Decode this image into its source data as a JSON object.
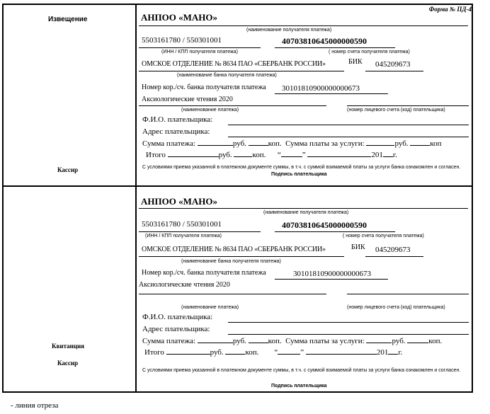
{
  "form_number": "Форма № ПД-4",
  "cut_line_note": "- линия отреза",
  "notice": {
    "title": "Извещение",
    "cashier": "Кассир"
  },
  "receipt_label": {
    "title": "Квитанция",
    "cashier": "Кассир"
  },
  "sections": [
    {
      "payee_name": "АНПОО «МАНО»",
      "payee_name_caption": "(наименование получателя платежа)",
      "inn_kpp": "5503161780 / 550301001",
      "account": "40703810645000000590",
      "inn_caption": "(ИНН / КПП получателя платежа)",
      "account_caption": "( номер счета получателя платежа)",
      "bank_name": "ОМСКОЕ ОТДЕЛЕНИЕ № 8634 ПАО «СБЕРБАНК РОССИИ»",
      "bik_label": "БИК",
      "bik": "045209673",
      "bank_caption": "(наименование банка получателя платежа)",
      "corr_label": "Номер кор./сч. банка получателя платежа",
      "corr_account": "30101810900000000673",
      "purpose": "Аксиологические чтения 2020",
      "purpose_caption": "(наименование платежа)",
      "personal_account_caption": "(номер лицевого счета (код) плательщика)",
      "fio_label": "Ф.И.О. плательщика:",
      "address_label": "Адрес плательщика:",
      "sum_label": "Сумма платежа:",
      "rub": "руб.",
      "kop": "коп.",
      "service_sum_label": "Сумма платы за услуги:",
      "kop_short": "коп",
      "total_label": "Итого",
      "quote_open": "“",
      "quote_close": "”",
      "year_prefix": "201",
      "year_suffix": "г.",
      "consent": "С условиями приема указанной в платежном документе суммы, в т.ч. с суммой взимаемой платы за услуги банка ознакомлен и согласен.",
      "signature": "Подпись плательщика"
    },
    {
      "payee_name": "АНПОО «МАНО»",
      "payee_name_caption": "(наименование получателя платежа)",
      "inn_kpp": "5503161780 / 550301001",
      "account": "40703810645000000590",
      "inn_caption": "(ИНН / КПП получателя платежа)",
      "account_caption": "( номер счета получателя платежа)",
      "bank_name": "ОМСКОЕ ОТДЕЛЕНИЕ № 8634 ПАО «СБЕРБАНК РОССИИ»",
      "bik_label": "БИК",
      "bik": "045209673",
      "bank_caption": "(наименование банка получателя платежа)",
      "corr_label": "Номер кор./сч. банка получателя платежа",
      "corr_account": "30101810900000000673",
      "purpose": "Аксиологические чтения 2020",
      "purpose_caption": "(наименование платежа)",
      "personal_account_caption": "(номер лицевого счета (код) плательщика)",
      "fio_label": "Ф.И.О. плательщика:",
      "address_label": "Адрес плательщика:",
      "sum_label": "Сумма платежа:",
      "rub": "руб.",
      "kop": "коп.",
      "service_sum_label": "Сумма платы за услуги:",
      "kop_short": "коп.",
      "total_label": "Итого",
      "quote_open": "“",
      "quote_close": "”",
      "year_prefix": "201",
      "year_suffix": "г.",
      "consent": "С условиями приема указанной в платежном документе суммы, в т.ч. с суммой взимаемой платы за услуги банка ознакомлен и согласен.",
      "signature": "Подпись плательщика"
    }
  ]
}
